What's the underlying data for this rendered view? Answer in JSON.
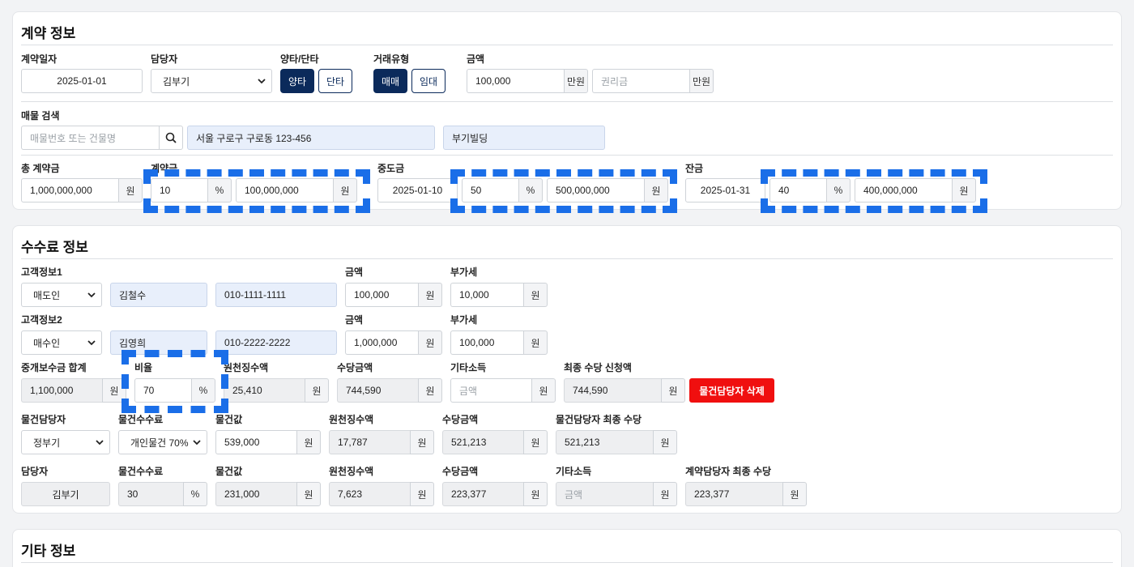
{
  "contract": {
    "title": "계약 정보",
    "contract_date": {
      "label": "계약일자",
      "value": "2025-01-01"
    },
    "manager": {
      "label": "담당자",
      "value": "김부기"
    },
    "party_type": {
      "label": "양타/단타",
      "options": [
        "양타",
        "단타"
      ],
      "selected": "양타"
    },
    "deal_type": {
      "label": "거래유형",
      "options": [
        "매매",
        "임대"
      ],
      "selected": "매매"
    },
    "amount": {
      "label": "금액",
      "value": "100,000",
      "unit": "만원",
      "premium_placeholder": "권리금",
      "premium_unit": "만원"
    },
    "property_search": {
      "label": "매물 검색",
      "placeholder": "매물번호 또는 건물명",
      "address": "서울 구로구 구로동 123-456",
      "building": "부기빌딩"
    },
    "total": {
      "label": "총 계약금",
      "value": "1,000,000,000",
      "unit": "원"
    },
    "deposit": {
      "label": "계약금",
      "percent": "10",
      "percent_unit": "%",
      "amount": "100,000,000",
      "unit": "원"
    },
    "middle": {
      "label": "중도금",
      "date": "2025-01-10",
      "percent": "50",
      "percent_unit": "%",
      "amount": "500,000,000",
      "unit": "원"
    },
    "balance": {
      "label": "잔금",
      "date": "2025-01-31",
      "percent": "40",
      "percent_unit": "%",
      "amount": "400,000,000",
      "unit": "원"
    }
  },
  "fee": {
    "title": "수수료 정보",
    "customer1": {
      "label": "고객정보1",
      "role": "매도인",
      "name": "김철수",
      "phone": "010-1111-1111",
      "amount_label": "금액",
      "amount": "100,000",
      "vat_label": "부가세",
      "vat": "10,000",
      "unit": "원"
    },
    "customer2": {
      "label": "고객정보2",
      "role": "매수인",
      "name": "김영희",
      "phone": "010-2222-2222",
      "amount_label": "금액",
      "amount": "1,000,000",
      "vat_label": "부가세",
      "vat": "100,000",
      "unit": "원"
    },
    "summary": {
      "total_label": "중개보수금 합계",
      "total": "1,100,000",
      "ratio_label": "비율",
      "ratio": "70",
      "ratio_unit": "%",
      "withholding_label": "원천징수액",
      "withholding": "25,410",
      "allowance_label": "수당금액",
      "allowance": "744,590",
      "other_label": "기타소득",
      "other_placeholder": "금액",
      "final_label": "최종 수당 신청액",
      "final": "744,590",
      "unit": "원",
      "delete_button": "물건담당자 삭제"
    },
    "property_manager": {
      "manager_label": "물건담당자",
      "manager": "정부기",
      "fee_label": "물건수수료",
      "fee": "개인물건 70%",
      "price_label": "물건값",
      "price": "539,000",
      "withholding_label": "원천징수액",
      "withholding": "17,787",
      "allowance_label": "수당금액",
      "allowance": "521,213",
      "final_label": "물건담당자 최종 수당",
      "final": "521,213",
      "unit": "원"
    },
    "contract_manager": {
      "manager_label": "담당자",
      "manager": "김부기",
      "fee_label": "물건수수료",
      "fee": "30",
      "fee_unit": "%",
      "price_label": "물건값",
      "price": "231,000",
      "withholding_label": "원천징수액",
      "withholding": "7,623",
      "allowance_label": "수당금액",
      "allowance": "223,377",
      "other_label": "기타소득",
      "other_placeholder": "금액",
      "final_label": "계약담당자 최종 수당",
      "final": "223,377",
      "unit": "원"
    }
  },
  "etc": {
    "title": "기타 정보"
  },
  "colors": {
    "navy": "#0b2a5b",
    "red": "#f00f0f",
    "highlight": "#1a6ee8",
    "readonly_blue": "#e8effb",
    "readonly_gray": "#eeeff1"
  }
}
